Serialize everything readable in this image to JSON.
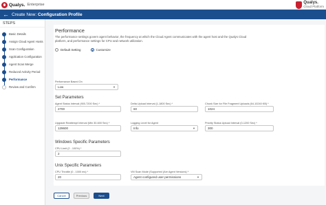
{
  "brand": {
    "name": "Qualys.",
    "edition": "Enterprise",
    "right_title": "Qualys.",
    "right_subtitle": "Cloud Platform"
  },
  "header": {
    "prefix": "Create New:",
    "title": "Configuration Profile"
  },
  "sidebar": {
    "heading": "STEPS",
    "steps": [
      {
        "label": "Basic Details",
        "state": "done"
      },
      {
        "label": "Assign Cloud Agent Hosts",
        "state": "done"
      },
      {
        "label": "Scan Configuration",
        "state": "done"
      },
      {
        "label": "Application Configuration",
        "state": "done"
      },
      {
        "label": "Agent Scan Merge",
        "state": "done"
      },
      {
        "label": "Reduced Activity Period",
        "state": "done"
      },
      {
        "label": "Performance",
        "state": "active"
      },
      {
        "label": "Review and Confirm",
        "state": "pending"
      }
    ]
  },
  "performance": {
    "title": "Performance",
    "description": "The performance settings govern agent behavior, the frequency at which the Cloud Agent communicates with the agent host and the Qualys Cloud platform, and performance settings for CPU and network utilization.",
    "radio_default": "Default Setting",
    "radio_customize": "Customize",
    "selected_radio": "customize",
    "based_on_label": "Performance Based On",
    "based_on_value": "Low"
  },
  "set_parameters": {
    "title": "Set Parameters",
    "fields": [
      {
        "label": "Agent Status Interval (900-7200 Sec) *",
        "value": "2700"
      },
      {
        "label": "Delta Upload Interval (1-1800 Sec) *",
        "value": "60"
      },
      {
        "label": "Chunk Size for File Fragment Uploads (64-10240 KB) *",
        "value": "1024"
      },
      {
        "label": "Upgrade Reattempt Interval (Min 30-600 Sec) *",
        "value": "129600"
      },
      {
        "label": "Logging Level for Agent",
        "value": "Info"
      },
      {
        "label": "Priority Status Upload Interval (0-1200 Sec) *",
        "value": "300"
      }
    ]
  },
  "windows": {
    "title": "Windows Specific Parameters",
    "cpu_label": "CPU Limit (2 - 100%) *",
    "cpu_value": "2"
  },
  "unix": {
    "title": "Unix Specific Parameters",
    "cpu_throttle_label": "CPU Throttle (0 - 1000 ms) *",
    "cpu_throttle_value": "20",
    "vm_scan_label": "VM Scan Mode (Supported (Are Agent Versions) *",
    "vm_scan_value": "Agent configured user permissions"
  },
  "footer": {
    "cancel": "Cancel",
    "previous": "Previous",
    "next": "Next"
  },
  "colors": {
    "primary": "#1b4e8d",
    "brand_red": "#c8202f"
  }
}
